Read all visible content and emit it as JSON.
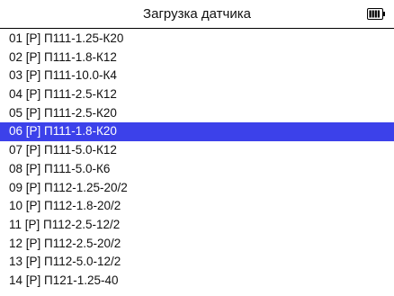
{
  "header": {
    "title": "Загрузка датчика",
    "battery_icon": "battery-full-icon"
  },
  "colors": {
    "selection": "#3c41ea",
    "text": "#111111",
    "background": "#ffffff"
  },
  "list": {
    "selected_index": 5,
    "items": [
      "01 [P]  П111-1.25-К20",
      "02 [P]  П111-1.8-К12",
      "03 [P]  П111-10.0-К4",
      "04 [P]  П111-2.5-К12",
      "05 [P]  П111-2.5-К20",
      "06 [P]  П111-1.8-К20",
      "07 [P]  П111-5.0-К12",
      "08 [P]  П111-5.0-К6",
      "09 [P]  П112-1.25-20/2",
      "10 [P]  П112-1.8-20/2",
      "11 [P]  П112-2.5-12/2",
      "12 [P]  П112-2.5-20/2",
      "13 [P]  П112-5.0-12/2",
      "14 [P]  П121-1.25-40"
    ]
  }
}
